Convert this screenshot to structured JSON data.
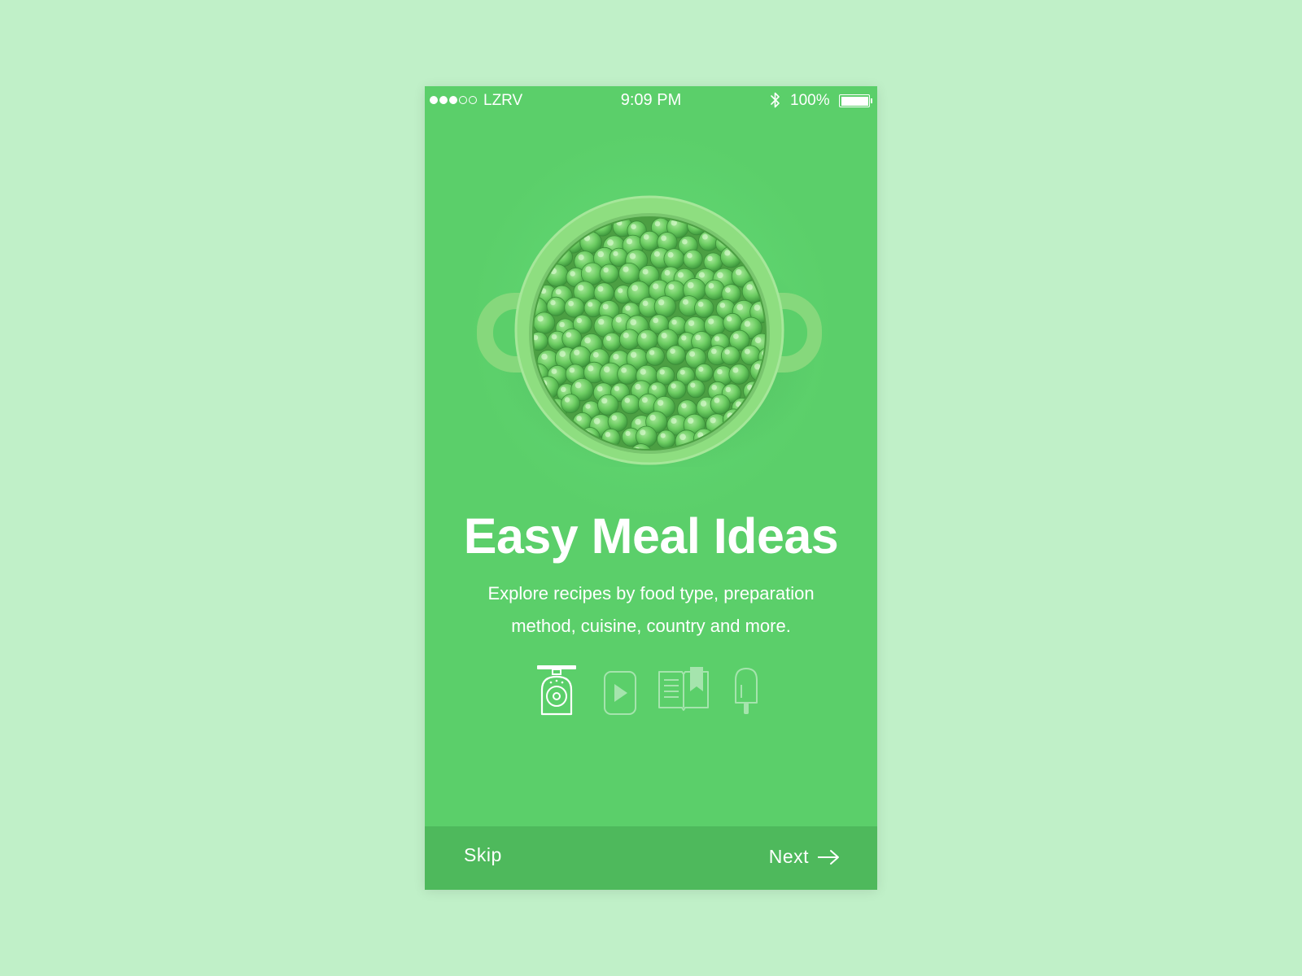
{
  "status_bar": {
    "carrier": "LZRV",
    "time": "9:09 PM",
    "battery": "100%",
    "signal_strength": 3,
    "signal_total": 5
  },
  "onboarding": {
    "image": "bowl-of-peas",
    "title": "Easy Meal Ideas",
    "subtitle_line1": "Explore recipes by food type, preparation",
    "subtitle_line2": "method, cuisine, country and more.",
    "categories": [
      {
        "icon": "kitchen-scale-icon",
        "active": true
      },
      {
        "icon": "video-play-icon",
        "active": false
      },
      {
        "icon": "recipe-book-icon",
        "active": false
      },
      {
        "icon": "popsicle-icon",
        "active": false
      }
    ]
  },
  "footer": {
    "skip_label": "Skip",
    "next_label": "Next"
  },
  "colors": {
    "page_background": "#c0f0c8",
    "screen_green": "#5bcf6a",
    "footer_green": "#4eb95c",
    "text": "#ffffff"
  }
}
